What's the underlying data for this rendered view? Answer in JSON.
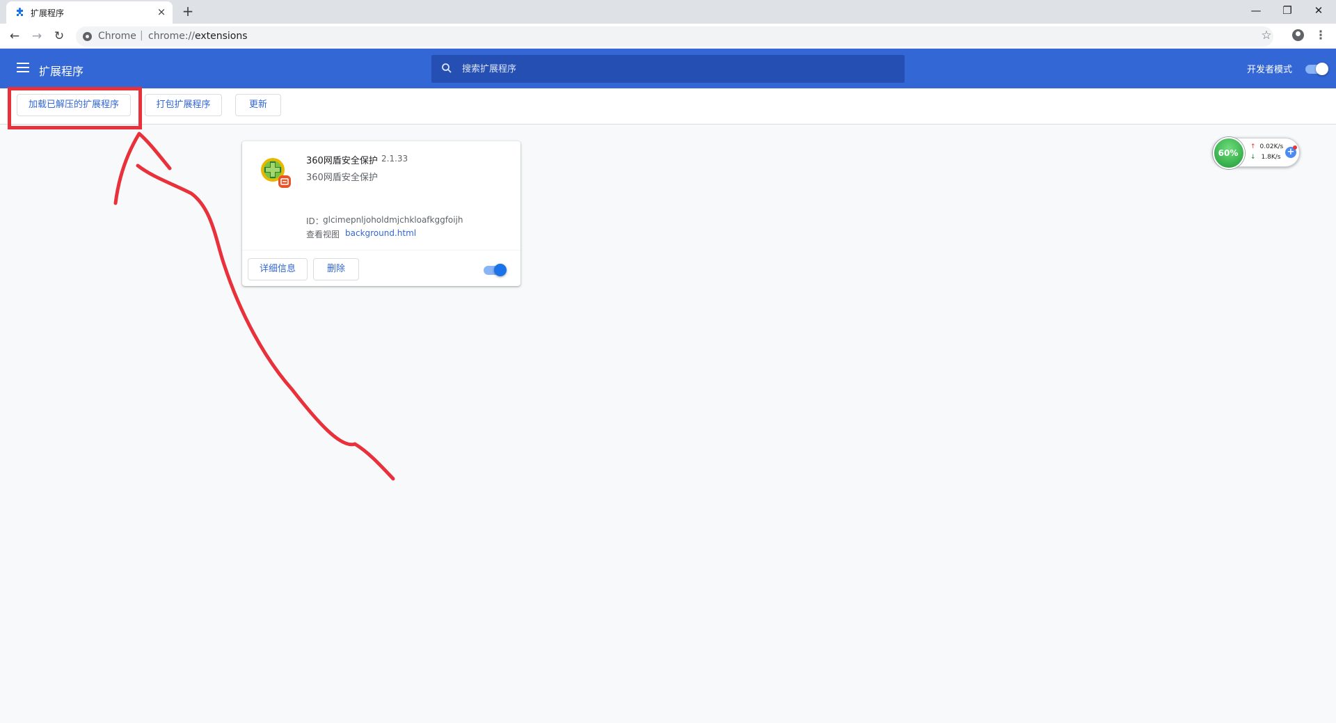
{
  "browser": {
    "tab_title": "扩展程序",
    "tab_close": "×",
    "new_tab": "+",
    "omnibox_label": "Chrome",
    "omnibox_separator": "|",
    "url_scheme": "chrome://",
    "url_path": "extensions",
    "window_controls": [
      "—",
      "❐",
      "✕"
    ]
  },
  "header": {
    "title": "扩展程序",
    "search_placeholder": "搜索扩展程序",
    "dev_mode_label": "开发者模式",
    "dev_mode_on": true,
    "accent_color": "#3367d6"
  },
  "actions": {
    "load_unpacked": "加载已解压的扩展程序",
    "pack_extension": "打包扩展程序",
    "update": "更新"
  },
  "extension": {
    "name": "360网盾安全保护",
    "version": "2.1.33",
    "description": "360网盾安全保护",
    "id_label": "ID：",
    "id": "glcimepnljoholdmjchkloafkggfoijh",
    "view_label": "查看视图",
    "view_link": "background.html",
    "details_button": "详细信息",
    "remove_button": "删除",
    "enabled": true
  },
  "speed_widget": {
    "percent": "60%",
    "up_arrow": "↑",
    "down_arrow": "↓",
    "upload": "0.02K/s",
    "download": "1.8K/s",
    "plus": "+"
  },
  "annotation": {
    "color": "#e8313a"
  }
}
